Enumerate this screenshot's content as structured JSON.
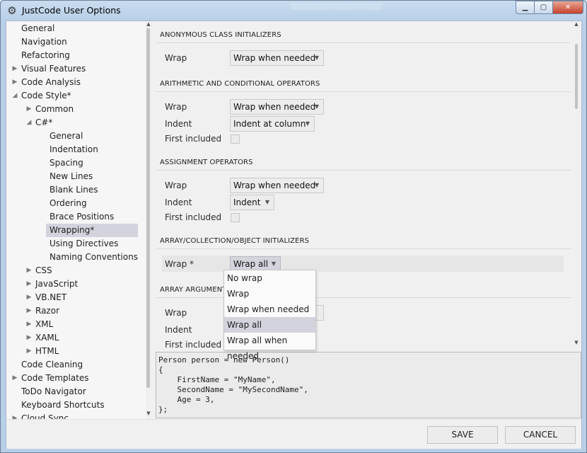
{
  "window": {
    "title": "JustCode User Options",
    "minimize": "▁",
    "maximize": "▢",
    "close": "✕"
  },
  "tree": {
    "items": [
      {
        "label": "General",
        "expander": ""
      },
      {
        "label": "Navigation",
        "expander": ""
      },
      {
        "label": "Refactoring",
        "expander": ""
      },
      {
        "label": "Visual Features",
        "expander": "▶"
      },
      {
        "label": "Code Analysis",
        "expander": "▶"
      },
      {
        "label": "Code Style*",
        "expander": "◢"
      },
      {
        "label": "Common",
        "expander": "▶"
      },
      {
        "label": "C#*",
        "expander": "◢"
      },
      {
        "label": "General",
        "expander": ""
      },
      {
        "label": "Indentation",
        "expander": ""
      },
      {
        "label": "Spacing",
        "expander": ""
      },
      {
        "label": "New Lines",
        "expander": ""
      },
      {
        "label": "Blank Lines",
        "expander": ""
      },
      {
        "label": "Ordering",
        "expander": ""
      },
      {
        "label": "Brace Positions",
        "expander": ""
      },
      {
        "label": "Wrapping*",
        "expander": ""
      },
      {
        "label": "Using Directives",
        "expander": ""
      },
      {
        "label": "Naming Conventions",
        "expander": ""
      },
      {
        "label": "CSS",
        "expander": "▶"
      },
      {
        "label": "JavaScript",
        "expander": "▶"
      },
      {
        "label": "VB.NET",
        "expander": "▶"
      },
      {
        "label": "Razor",
        "expander": "▶"
      },
      {
        "label": "XML",
        "expander": "▶"
      },
      {
        "label": "XAML",
        "expander": "▶"
      },
      {
        "label": "HTML",
        "expander": "▶"
      },
      {
        "label": "Code Cleaning",
        "expander": ""
      },
      {
        "label": "Code Templates",
        "expander": "▶"
      },
      {
        "label": "ToDo Navigator",
        "expander": ""
      },
      {
        "label": "Keyboard Shortcuts",
        "expander": ""
      },
      {
        "label": "Cloud Sync",
        "expander": "▶"
      }
    ],
    "selected": "Wrapping*",
    "scroll_up": "▲",
    "scroll_down": "▼"
  },
  "settings": {
    "sections": [
      {
        "title": "ANONYMOUS CLASS INITIALIZERS",
        "rows": [
          {
            "label": "Wrap",
            "value": "Wrap when needed"
          }
        ]
      },
      {
        "title": "ARITHMETIC AND CONDITIONAL OPERATORS",
        "rows": [
          {
            "label": "Wrap",
            "value": "Wrap when needed"
          },
          {
            "label": "Indent",
            "value": "Indent at column"
          },
          {
            "label": "First included",
            "checked": false
          }
        ]
      },
      {
        "title": "ASSIGNMENT OPERATORS",
        "rows": [
          {
            "label": "Wrap",
            "value": "Wrap when needed"
          },
          {
            "label": "Indent",
            "value": "Indent"
          },
          {
            "label": "First included",
            "checked": false
          }
        ]
      },
      {
        "title": "ARRAY/COLLECTION/OBJECT INITIALIZERS",
        "rows": [
          {
            "label": "Wrap *",
            "value": "Wrap all"
          }
        ]
      },
      {
        "title": "ARRAY ARGUMENTS",
        "rows": [
          {
            "label": "Wrap"
          },
          {
            "label": "Indent"
          },
          {
            "label": "First included"
          }
        ]
      }
    ],
    "dropdown_arrow": "▼",
    "scroll_up": "▲",
    "scroll_down": "▼"
  },
  "dropdown": {
    "options": [
      "No wrap",
      "Wrap",
      "Wrap when needed",
      "Wrap all",
      "Wrap all when needed"
    ],
    "selected": "Wrap all"
  },
  "preview": {
    "code": "Person person = new Person()\n{\n    FirstName = \"MyName\",\n    SecondName = \"MySecondName\",\n    Age = 3,\n};"
  },
  "footer": {
    "save_label": "SAVE",
    "cancel_label": "CANCEL"
  },
  "colors": {
    "selection": "#d3d3de",
    "background": "#f0f0f0"
  }
}
